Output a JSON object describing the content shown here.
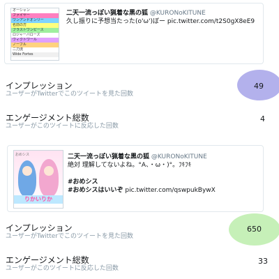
{
  "tweets": [
    {
      "author_name": "二天一流っぽい猟着な黒の狐",
      "author_handle": "@KURONoKITUNE",
      "body": "久し振りに予想当たった(o'ω')ぼー pic.twitter.com/t2S0gX8eE9",
      "thumbnail_rows": [
        "オーシャン",
        "ファイヤー",
        "ワンアンドオンリー",
        "名前の方",
        "ブラストワンピース",
        "ロジャーバローズ",
        "ヴィクトワール",
        "ノーブル",
        "二刀流",
        "Wide Fortes"
      ],
      "impressions_label": "インプレッション",
      "impressions_sub": "ユーザーがTwitterでこのツイートを見た回数",
      "impressions_value": "49",
      "engagement_label": "エンゲージメント総数",
      "engagement_sub": "ユーザーがこのツイートに反応した回数",
      "engagement_value": "4"
    },
    {
      "author_name": "二天一流っぽい猟着な黒の狐",
      "author_handle": "@KURONoKITUNE",
      "body_line1": "絶対 理解してないよね。°A、・ω・)°。ﾌｷﾌｷ",
      "hashtag1": "#おめシス",
      "hashtag2": "#おめシスはいいぞ",
      "link2": "pic.twitter.com/qswpukBywX",
      "thumbnail_banner": "りかいりか",
      "thumbnail_tag": "おめシス",
      "impressions_label": "インプレッション",
      "impressions_sub": "ユーザーがTwitterでこのツイートを見た回数",
      "impressions_value": "650",
      "engagement_label": "エンゲージメント総数",
      "engagement_sub": "ユーザーがこのツイートに反応した回数",
      "engagement_value": "33"
    }
  ],
  "colors": {
    "highlight_1": "#b3b1ec",
    "highlight_2": "#c6f0b8"
  }
}
